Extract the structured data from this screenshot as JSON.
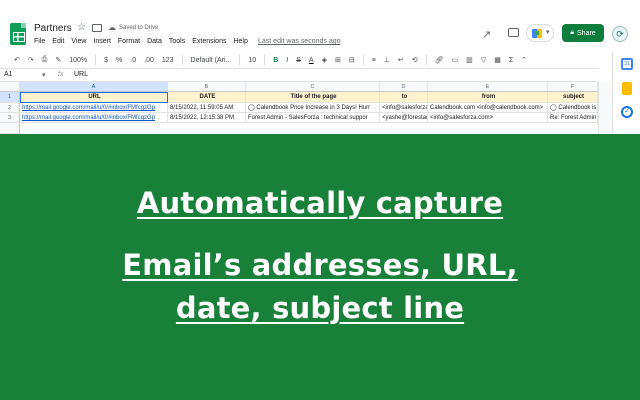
{
  "app": {
    "doc_title": "Partners",
    "saved_status": "Saved to Drive",
    "menu": [
      "File",
      "Edit",
      "View",
      "Insert",
      "Format",
      "Data",
      "Tools",
      "Extensions",
      "Help"
    ],
    "last_edit": "Last edit was seconds ago",
    "share_label": "Share",
    "icons": [
      "star-icon",
      "folder-icon",
      "cloud-icon",
      "trend-icon",
      "comment-icon",
      "meet-icon",
      "lock-icon",
      "avatar-icon"
    ]
  },
  "toolbar": {
    "zoom": "100%",
    "currency": "$",
    "percent": "%",
    "decimal_decrease": ".0",
    "decimal_increase": ".00",
    "format_more": "123",
    "font": "Default (Ari...",
    "font_size": "10",
    "bold": "B",
    "italic": "I",
    "strike": "S",
    "text_color": "A"
  },
  "formula_bar": {
    "cell_ref": "A1",
    "fx": "fx",
    "value": "URL"
  },
  "sheet": {
    "columns": [
      "A",
      "B",
      "C",
      "D",
      "E",
      "F"
    ],
    "rows": [
      {
        "num": "1",
        "cells": [
          "URL",
          "DATE",
          "Title of the page",
          "to",
          "from",
          "subject"
        ]
      },
      {
        "num": "2",
        "cells": [
          "https://mail.google.com/mail/u/0/#inbox/FMfcgzGp",
          "8/15/2022, 11:59:05 AM",
          "Calendbook Price Increase in 3 Days! Hurr",
          "<info@salesforza",
          "Calendbook.com <info@calendbook.com>",
          "Calendbook is"
        ]
      },
      {
        "num": "3",
        "cells": [
          "https://mail.google.com/mail/u/0/#inbox/FMfcgzGp",
          "8/15/2022, 12:15:38 PM",
          "Forest Admin - SalesForza : technical suppor",
          "<yashe@forestadm",
          "<info@salesforza.com>",
          "Re: Forest Admin"
        ]
      }
    ]
  },
  "promo": {
    "line1": "Automatically capture",
    "line2": "Email’s addresses, URL,",
    "line3": "date, subject line"
  },
  "colors": {
    "brand_green": "#188038",
    "share_green": "#0f7d3b",
    "header_fill": "#fff2cc",
    "link_blue": "#1155cc"
  }
}
